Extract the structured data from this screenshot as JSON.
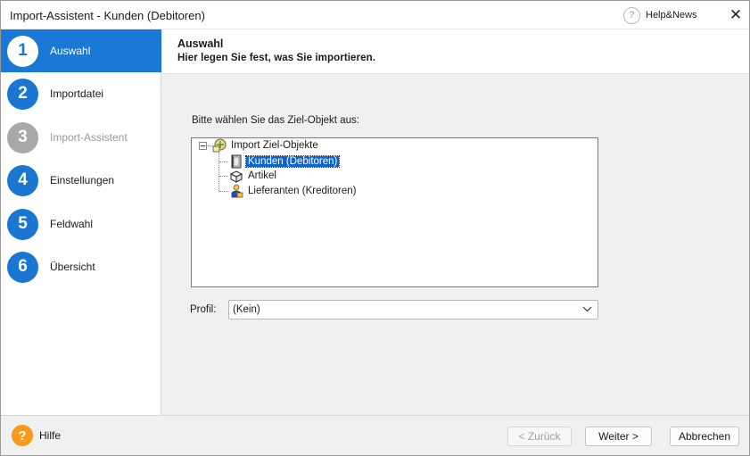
{
  "window": {
    "title": "Import-Assistent - Kunden (Debitoren)",
    "help_news_label": "Help&News",
    "close_glyph": "✕"
  },
  "sidebar": {
    "steps": [
      {
        "number": "1",
        "label": "Auswahl",
        "state": "active"
      },
      {
        "number": "2",
        "label": "Importdatei",
        "state": "enabled"
      },
      {
        "number": "3",
        "label": "Import-Assistent",
        "state": "disabled"
      },
      {
        "number": "4",
        "label": "Einstellungen",
        "state": "enabled"
      },
      {
        "number": "5",
        "label": "Feldwahl",
        "state": "enabled"
      },
      {
        "number": "6",
        "label": "Übersicht",
        "state": "enabled"
      }
    ]
  },
  "header": {
    "title": "Auswahl",
    "subtitle": "Hier legen Sie fest, was Sie importieren."
  },
  "main": {
    "prompt": "Bitte wählen Sie das Ziel-Objekt aus:",
    "tree": {
      "root_label": "Import Ziel-Objekte",
      "items": [
        {
          "label": "Kunden (Debitoren)",
          "selected": true,
          "icon": "customer-book-icon"
        },
        {
          "label": "Artikel",
          "selected": false,
          "icon": "article-boxes-icon"
        },
        {
          "label": "Lieferanten (Kreditoren)",
          "selected": false,
          "icon": "supplier-person-icon"
        }
      ]
    },
    "profil": {
      "label": "Profil:",
      "value": "(Kein)"
    }
  },
  "footer": {
    "help_label": "Hilfe",
    "back_label": "< Zurück",
    "next_label": "Weiter >",
    "cancel_label": "Abbrechen"
  },
  "colors": {
    "accent": "#1a78d6",
    "step_circle": "#1977d2",
    "disabled_circle": "#a8a8a8",
    "selection": "#0a64d4",
    "help_orange": "#f59a1b"
  }
}
